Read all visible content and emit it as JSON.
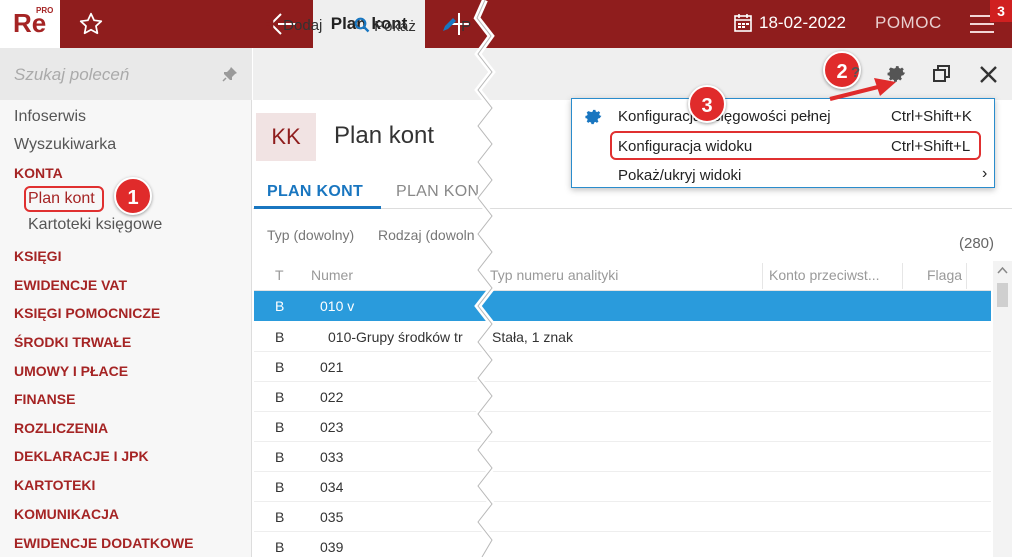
{
  "app": {
    "logo_text": "Re",
    "logo_badge": "PRO",
    "active_tab": "Plan kont",
    "date": "18-02-2022",
    "help_label": "POMOC",
    "notification_count": "3"
  },
  "sidebar": {
    "search_placeholder": "Szukaj poleceń",
    "items": [
      {
        "label": "Infoserwis",
        "kind": "item"
      },
      {
        "label": "Wyszukiwarka",
        "kind": "item"
      },
      {
        "label": "KONTA",
        "kind": "section"
      },
      {
        "label": "Plan kont",
        "kind": "sub",
        "active": true
      },
      {
        "label": "Kartoteki księgowe",
        "kind": "sub"
      },
      {
        "label": "KSIĘGI",
        "kind": "section"
      },
      {
        "label": "EWIDENCJE VAT",
        "kind": "section"
      },
      {
        "label": "KSIĘGI POMOCNICZE",
        "kind": "section"
      },
      {
        "label": "ŚRODKI TRWAŁE",
        "kind": "section"
      },
      {
        "label": "UMOWY I PŁACE",
        "kind": "section"
      },
      {
        "label": "FINANSE",
        "kind": "section"
      },
      {
        "label": "ROZLICZENIA",
        "kind": "section"
      },
      {
        "label": "DEKLARACJE I JPK",
        "kind": "section"
      },
      {
        "label": "KARTOTEKI",
        "kind": "section"
      },
      {
        "label": "KOMUNIKACJA",
        "kind": "section"
      },
      {
        "label": "EWIDENCJE DODATKOWE",
        "kind": "section"
      }
    ]
  },
  "toolbar": {
    "add_label": "Dodaj",
    "show_label": "Pokaż",
    "edit_label_partial": "P"
  },
  "page": {
    "badge": "KK",
    "title": "Plan kont",
    "tabs": [
      "PLAN KONT",
      "PLAN KON"
    ],
    "filters": [
      "Typ (dowolny)",
      "Rodzaj (dowoln"
    ],
    "count": "(280)"
  },
  "grid": {
    "columns": [
      "T",
      "Numer",
      "Typ numeru analityki",
      "Konto przeciwst...",
      "Flaga"
    ],
    "rows": [
      {
        "t": "B",
        "numer": "010 v",
        "typ": "",
        "selected": true
      },
      {
        "t": "B",
        "numer": "010-Grupy środków tr",
        "typ": "Stała, 1 znak",
        "indent": true
      },
      {
        "t": "B",
        "numer": "021",
        "typ": ""
      },
      {
        "t": "B",
        "numer": "022",
        "typ": ""
      },
      {
        "t": "B",
        "numer": "023",
        "typ": ""
      },
      {
        "t": "B",
        "numer": "033",
        "typ": ""
      },
      {
        "t": "B",
        "numer": "034",
        "typ": ""
      },
      {
        "t": "B",
        "numer": "035",
        "typ": ""
      },
      {
        "t": "B",
        "numer": "039",
        "typ": ""
      }
    ]
  },
  "dropdown": {
    "items": [
      {
        "label": "Konfiguracja księgowości pełnej",
        "shortcut": "Ctrl+Shift+K",
        "icon": "gear-icon"
      },
      {
        "label": "Konfiguracja widoku",
        "shortcut": "Ctrl+Shift+L",
        "highlighted": true
      },
      {
        "label": "Pokaż/ukryj widoki",
        "shortcut": "",
        "submenu": true
      }
    ]
  },
  "annotations": {
    "badges": [
      "1",
      "2",
      "3"
    ],
    "help_mark": "?",
    "accent_color": "#e02b2b"
  },
  "colors": {
    "brand": "#8f1d1d",
    "section_text": "#a52424",
    "selection": "#2a9bdc",
    "tab_active": "#1976c0"
  }
}
